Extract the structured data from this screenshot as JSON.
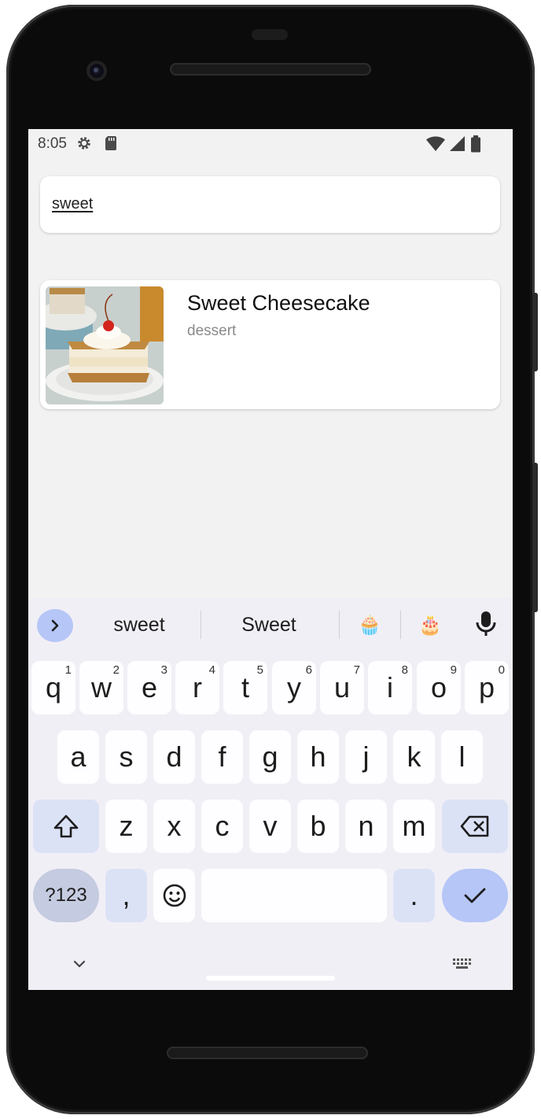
{
  "status_bar": {
    "time": "8:05",
    "icons": [
      "settings-gear-icon",
      "sd-card-icon",
      "wifi-icon",
      "signal-icon",
      "battery-icon"
    ]
  },
  "search": {
    "value": "sweet"
  },
  "results": [
    {
      "title": "Sweet Cheesecake",
      "category": "dessert"
    }
  ],
  "keyboard": {
    "suggestions": [
      "sweet",
      "Sweet"
    ],
    "emoji_suggestions": [
      "🧁",
      "🎂"
    ],
    "row1": [
      {
        "label": "q",
        "hint": "1"
      },
      {
        "label": "w",
        "hint": "2"
      },
      {
        "label": "e",
        "hint": "3"
      },
      {
        "label": "r",
        "hint": "4"
      },
      {
        "label": "t",
        "hint": "5"
      },
      {
        "label": "y",
        "hint": "6"
      },
      {
        "label": "u",
        "hint": "7"
      },
      {
        "label": "i",
        "hint": "8"
      },
      {
        "label": "o",
        "hint": "9"
      },
      {
        "label": "p",
        "hint": "0"
      }
    ],
    "row2": [
      "a",
      "s",
      "d",
      "f",
      "g",
      "h",
      "j",
      "k",
      "l"
    ],
    "row3": [
      "z",
      "x",
      "c",
      "v",
      "b",
      "n",
      "m"
    ],
    "symbols_label": "?123",
    "comma_label": ",",
    "period_label": "."
  },
  "colors": {
    "screen_bg": "#f2f2f2",
    "keyboard_bg": "#f1eff6",
    "accent": "#b5c6f7",
    "function_key": "#dce2f6"
  }
}
